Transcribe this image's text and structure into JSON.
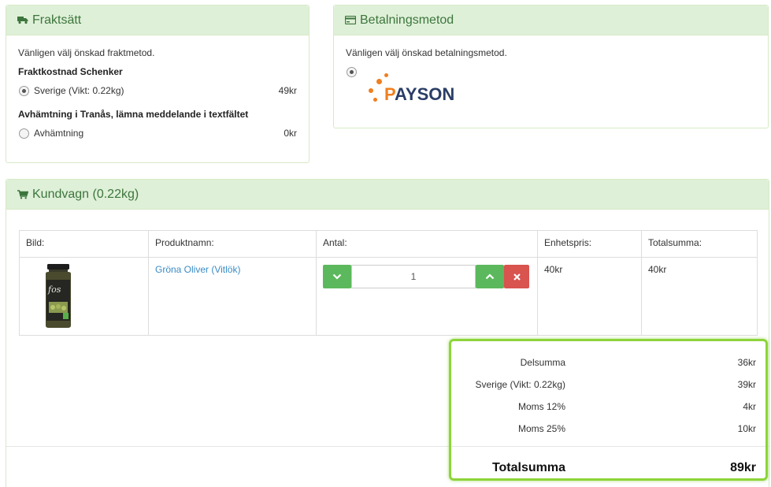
{
  "shipping": {
    "title": "Fraktsätt",
    "intro": "Vänligen välj önskad fraktmetod.",
    "groups": [
      {
        "heading": "Fraktkostnad Schenker",
        "option": "Sverige (Vikt: 0.22kg)",
        "price": "49kr",
        "selected": true
      },
      {
        "heading": "Avhämtning i Tranås, lämna meddelande i textfältet",
        "option": "Avhämtning",
        "price": "0kr",
        "selected": false
      }
    ]
  },
  "payment": {
    "title": "Betalningsmetod",
    "intro": "Vänligen välj önskad betalningsmetod.",
    "logo_text_first": "P",
    "logo_text_rest": "AYSON"
  },
  "cart": {
    "title": "Kundvagn (0.22kg)",
    "headers": [
      "Bild:",
      "Produktnamn:",
      "Antal:",
      "Enhetspris:",
      "Totalsumma:"
    ],
    "items": [
      {
        "name": "Gröna Oliver (Vitlök)",
        "quantity": "1",
        "unit_price": "40kr",
        "total": "40kr"
      }
    ]
  },
  "summary": {
    "rows": [
      {
        "label": "Delsumma",
        "value": "36kr"
      },
      {
        "label": "Sverige (Vikt: 0.22kg)",
        "value": "39kr"
      },
      {
        "label": "Moms 12%",
        "value": "4kr"
      },
      {
        "label": "Moms 25%",
        "value": "10kr"
      }
    ],
    "total_label": "Totalsumma",
    "total_value": "89kr"
  },
  "colors": {
    "panel_heading_bg": "#dff0d8",
    "panel_heading_text": "#3c763d",
    "btn_green": "#5cb85c",
    "btn_red": "#d9534f",
    "link": "#3a8bc7",
    "highlight": "#8dd43a",
    "payson_orange": "#f07f1f",
    "payson_navy": "#2a3d66"
  }
}
